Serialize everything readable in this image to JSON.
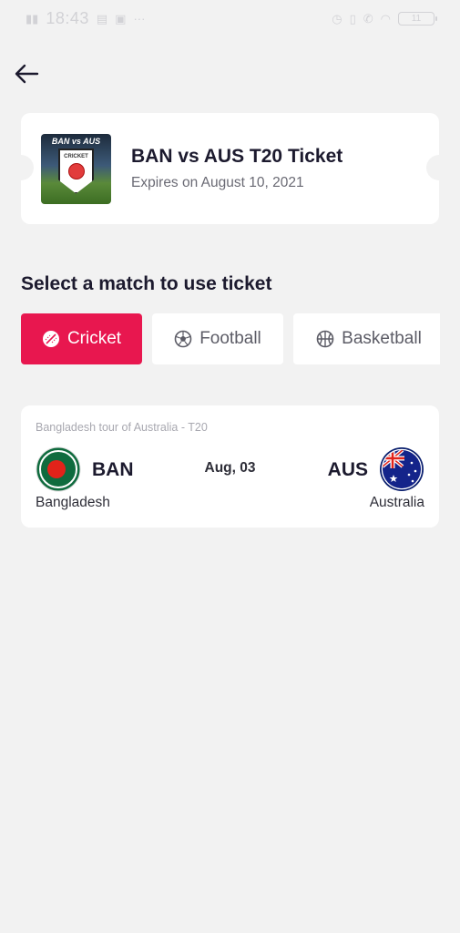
{
  "status_bar": {
    "time": "18:43",
    "battery": "11"
  },
  "ticket": {
    "title": "BAN vs AUS T20 Ticket",
    "expiry": "Expires on August 10, 2021",
    "thumbnail_title": "BAN vs AUS",
    "thumbnail_label": "CRICKET"
  },
  "section_title": "Select a match to use ticket",
  "tabs": [
    {
      "label": "Cricket",
      "icon": "cricket-ball-icon",
      "active": true
    },
    {
      "label": "Football",
      "icon": "football-icon",
      "active": false
    },
    {
      "label": "Basketball",
      "icon": "basketball-icon",
      "active": false
    }
  ],
  "match": {
    "series": "Bangladesh tour of Australia - T20",
    "date": "Aug, 03",
    "home": {
      "code": "BAN",
      "name": "Bangladesh"
    },
    "away": {
      "code": "AUS",
      "name": "Australia"
    }
  },
  "colors": {
    "accent": "#e8174f",
    "background": "#f2f2f2",
    "card": "#ffffff",
    "text_primary": "#1c1a2e"
  }
}
